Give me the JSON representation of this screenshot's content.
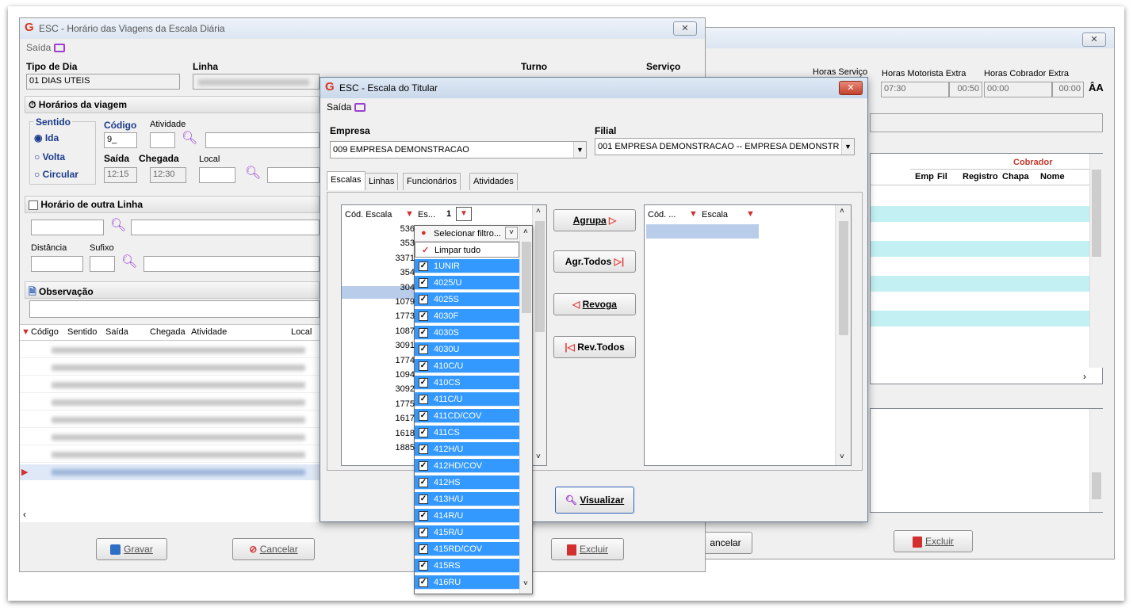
{
  "win1": {
    "title": "ESC - Horário das Viagens da Escala Diária",
    "menu_saida": "Saída",
    "tipo_dia_label": "Tipo de Dia",
    "tipo_dia_value": "01 DIAS UTEIS",
    "linha_label": "Linha",
    "turno_label": "Turno",
    "servico_label": "Serviço",
    "horarios_section": "Horários da viagem",
    "sentido_label": "Sentido",
    "sentido_options": [
      "Ida",
      "Volta",
      "Circular"
    ],
    "codigo_label": "Código",
    "codigo_value": "9_",
    "atividade_label": "Atividade",
    "saida_label": "Saída",
    "saida_value": "12:15",
    "chegada_label": "Chegada",
    "chegada_value": "12:30",
    "local_label": "Local",
    "outra_linha_section": "Horário de outra Linha",
    "distancia_label": "Distância",
    "sufixo_label": "Sufixo",
    "observacao_section": "Observação",
    "grid_headers": [
      "Código",
      "Sentido",
      "Saída",
      "Chegada",
      "Atividade",
      "Local"
    ],
    "gravar_button": "Gravar",
    "cancelar_button": "Cancelar",
    "excluir_button": "Excluir"
  },
  "win2": {
    "horas_servico_label": "Horas Serviço",
    "horas_motorista_label": "Horas Motorista Extra",
    "horas_cobrador_label": "Horas Cobrador Extra",
    "hm_value": "07:30",
    "hm_extra_value": "00:50",
    "hc_value": "00:00",
    "hc_extra_value": "00:00",
    "cobrador_header": "Cobrador",
    "sub_headers": [
      "Emp",
      "Fil",
      "Registro",
      "Chapa",
      "Nome"
    ],
    "cancelar_button": "ancelar",
    "excluir_button": "Excluir"
  },
  "dialog": {
    "title": "ESC - Escala do Titular",
    "menu_saida": "Saída",
    "empresa_label": "Empresa",
    "empresa_value": "009 EMPRESA DEMONSTRACAO",
    "filial_label": "Filial",
    "filial_value": "001 EMPRESA DEMONSTRACAO -- EMPRESA DEMONSTR",
    "tabs": [
      "Escalas",
      "Linhas",
      "Funcionários",
      "Atividades"
    ],
    "left_headers": {
      "cod": "Cód. Escala",
      "es": "Es...",
      "num": "1"
    },
    "left_codes": [
      "536",
      "353",
      "3371",
      "354",
      "304",
      "1079",
      "1773",
      "1087",
      "3091",
      "1774",
      "1094",
      "3092",
      "1775",
      "1617",
      "1618",
      "1885"
    ],
    "right_headers": {
      "cod": "Cód. ...",
      "escala": "Escala"
    },
    "agrupa_button": "Agrupa",
    "agr_todos_button": "Agr.Todos",
    "revoga_button": "Revoga",
    "rev_todos_button": "Rev.Todos",
    "visualizar_button": "Visualizar"
  },
  "dropdown": {
    "selecionar": "Selecionar filtro...",
    "limpar": "Limpar tudo",
    "items": [
      "1UNIR",
      "4025/U",
      "4025S",
      "4030F",
      "4030S",
      "4030U",
      "410C/U",
      "410CS",
      "411C/U",
      "411CD/COV",
      "411CS",
      "412H/U",
      "412HD/COV",
      "412HS",
      "413H/U",
      "414R/U",
      "415R/U",
      "415RD/COV",
      "415RS",
      "416RU"
    ]
  },
  "colors": {
    "accent_red": "#d9361b",
    "selection_blue": "#3399ff",
    "teal_row": "#c3f0f2",
    "magnifier": "#9a3fd0"
  }
}
